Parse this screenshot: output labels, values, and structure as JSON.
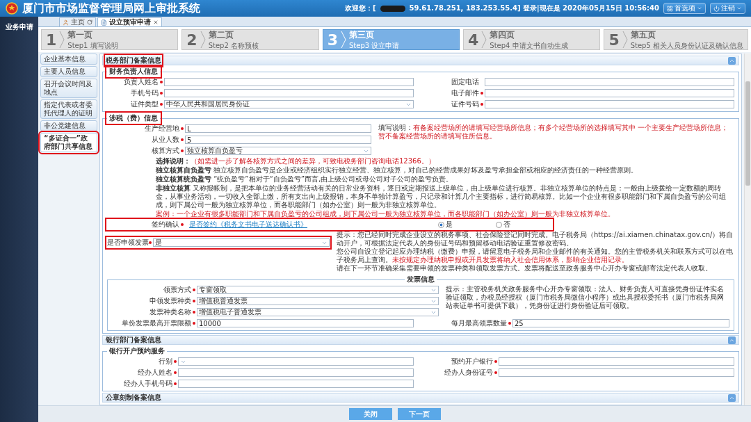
{
  "header": {
    "title": "厦门市市场监督管理局网上审批系统",
    "welcome": "欢迎您：[",
    "session": "59.61.78.251, 183.253.55.4] 登录|现在是 2020年05月15日 10:56:40",
    "buttons": [
      {
        "label": "首选项",
        "kind": "preferences"
      },
      {
        "label": "注销",
        "kind": "logout"
      }
    ]
  },
  "rail": {
    "items": [
      {
        "label": "业务申请"
      }
    ]
  },
  "tabs": [
    {
      "label": "主页",
      "kind": "home",
      "selected": false
    },
    {
      "label": "设立预审申请",
      "kind": "document",
      "selected": true
    }
  ],
  "steps": [
    {
      "number": "1",
      "title": "第一页",
      "subtitle": "Step1 填写说明",
      "selected": false
    },
    {
      "number": "2",
      "title": "第二页",
      "subtitle": "Step2 名称预核",
      "selected": false
    },
    {
      "number": "3",
      "title": "第三页",
      "subtitle": "Step3 设立申请",
      "selected": true
    },
    {
      "number": "4",
      "title": "第四页",
      "subtitle": "Step4 申请文书自动生成",
      "selected": false
    },
    {
      "number": "5",
      "title": "第五页",
      "subtitle": "Step5 相关人员身份认证及确认信息",
      "selected": false
    }
  ],
  "nav": [
    {
      "label": "企业基本信息",
      "selected": false,
      "highlighted": false
    },
    {
      "label": "主要人员信息",
      "selected": false,
      "highlighted": false
    },
    {
      "label": "召开会议时间及地点",
      "selected": false,
      "highlighted": false
    },
    {
      "label": "指定代表或者委托代理人的证明",
      "selected": false,
      "highlighted": false
    },
    {
      "label": "非公党建信息",
      "selected": false,
      "highlighted": false
    },
    {
      "label": "“多证合一”政府部门共享信息",
      "selected": true,
      "highlighted": true
    }
  ],
  "tax_panel": {
    "title": "税务部门备案信息",
    "highlighted": true,
    "finance": {
      "legend": "财务负责人信息",
      "highlighted": true,
      "fields": [
        {
          "label": "负责人姓名",
          "required": true,
          "kind": "text"
        },
        {
          "label": "固定电话",
          "required": false,
          "kind": "text"
        },
        {
          "label": "手机号码",
          "required": true,
          "kind": "text"
        },
        {
          "label": "电子邮件",
          "required": true,
          "kind": "text"
        },
        {
          "label": "证件类型",
          "required": true,
          "kind": "select",
          "value": "中华人民共和国居民身份证"
        },
        {
          "label": "证件号码",
          "required": true,
          "kind": "text"
        }
      ]
    },
    "taxation": {
      "legend": "涉税（费）信息",
      "highlighted": true,
      "fields": [
        {
          "label": "生产经营地",
          "required": true,
          "kind": "text",
          "value": "L"
        },
        {
          "label": "从业人数",
          "required": true,
          "kind": "text",
          "value": "5"
        },
        {
          "label": "核算方式",
          "required": true,
          "kind": "select",
          "value": "独立核算自负盈亏"
        }
      ],
      "note_label": "填写说明：",
      "note": "有备案经营场所的请填写经营场所信息；有多个经营场所的选择填写其中 一个主要生产经营场所信息；暂不备案经营场所的请填写住所信息。",
      "explanation": {
        "title": "选择说明：",
        "hint": "（如需进一步了解各核算方式之间的差异，可致电税务部门咨询电话12366。）",
        "items": [
          {
            "kind": "term",
            "term": "独立核算自负盈亏",
            "text": "独立核算自负盈亏是企业或经济组织实行独立经营、独立核算，对自己的经营成果好坏及盈亏承担全部或相应的经济责任的一种经营原则。"
          },
          {
            "kind": "term",
            "term": "独立核算统负盈亏",
            "text": "“统负盈亏”相对于“自负盈亏”而言,由上级公司或母公司对子公司的盈亏负责。"
          },
          {
            "kind": "term",
            "term": "非独立核算",
            "text": "又称报帐制，是把本单位的业务经营活动有关的日常业务资料，逐日或定期报送上级单位，由上级单位进行核算。非独立核算单位的特点是：一般由上级拨给一定数额的周转金，从事业务活动，一切收入全部上缴，所有支出向上级报销，本身不单独计算盈亏，只记录和计算几个主要指标，进行简易核算。比如一个企业有很多职能部门和下属自负盈亏的公司组成，则下属公司一般为独立核算单位，而各职能部门（如办公室）则一般为非独立核算单位。"
          },
          {
            "kind": "case",
            "term": "案例：",
            "text": "一个企业有很多职能部门和下属自负盈亏的公司组成，则下属公司一般为独立核算单位，而各职能部门（如办公室）则一般为非独立核算单位。"
          }
        ]
      },
      "signing": {
        "label": "签约确认",
        "required": true,
        "highlighted": true,
        "link": "是否签约《税务文书电子送达确认书》",
        "options": [
          {
            "label": "是",
            "selected": true
          },
          {
            "label": "否",
            "selected": false
          }
        ]
      },
      "invoice_request": {
        "label": "是否申领发票",
        "required": true,
        "kind": "select",
        "value": "是",
        "highlighted": true
      },
      "tips": [
        {
          "segments": [
            {
              "text": "提示：您已经同时完成企业设立的税务事项、社会保险登记同时完成。电子税务局（https://ai.xiamen.chinatax.gov.cn/）将自动开户，可根据法定代表人的身份证号码和预留移动电话验证重置修改密码。",
              "warning": false
            }
          ]
        },
        {
          "segments": [
            {
              "text": "您公司自设立登记起应办理纳税（缴费）申报，请留意电子税务局和企业邮件的有关通知。您的主管税务机关和联系方式可以在电子税务局上查询。",
              "warning": false
            },
            {
              "text": "未按规定办理纳税申报或开具发票将纳入社会信用体系，影响企业信用记录。",
              "warning": true
            }
          ]
        },
        {
          "segments": [
            {
              "text": "请在下一环节准确采集需要申领的发票种类和领取发票方式。发票将配送至政务服务中心开办专窗或邮寄法定代表人收取。",
              "warning": false
            }
          ]
        }
      ],
      "invoice": {
        "legend": "发票信息",
        "fields": [
          {
            "label": "领票方式",
            "required": true,
            "kind": "select",
            "value": "专窗领取"
          },
          {
            "label": "申领发票种类",
            "required": true,
            "kind": "select",
            "value": "增值税普通发票"
          },
          {
            "label": "发票种类名称",
            "required": true,
            "kind": "select",
            "value": "增值税电子普通发票"
          },
          {
            "label": "单份发票最高开票限额",
            "required": true,
            "kind": "text",
            "value": "10000"
          },
          {
            "label": "每月最高领票数量",
            "required": true,
            "kind": "text",
            "value": "25"
          }
        ],
        "note": "提示：主管税务机关政务服务中心开办专窗领取：法人、财务负责人可直接凭身份证件实名验证领取，办税员经授权（厦门市税务局微信小程序）或出具授权委托书（厦门市税务局网站表证单书可提供下载），凭身份证进行身份验证后可领取。"
      }
    }
  },
  "bank_panel": {
    "title": "银行部门备案信息",
    "group": {
      "legend": "银行开户预约服务",
      "fields": [
        {
          "label": "行别",
          "required": true,
          "kind": "select"
        },
        {
          "label": "预约开户银行",
          "required": true,
          "kind": "text"
        },
        {
          "label": "经办人姓名",
          "required": true,
          "kind": "text"
        },
        {
          "label": "经办人身份证号",
          "required": true,
          "kind": "text"
        },
        {
          "label": "经办人手机号码",
          "required": true,
          "kind": "text"
        }
      ]
    }
  },
  "seal_panel": {
    "title": "公章刻制备案信息"
  },
  "buttons": [
    {
      "label": "关闭"
    },
    {
      "label": "下一页"
    }
  ]
}
